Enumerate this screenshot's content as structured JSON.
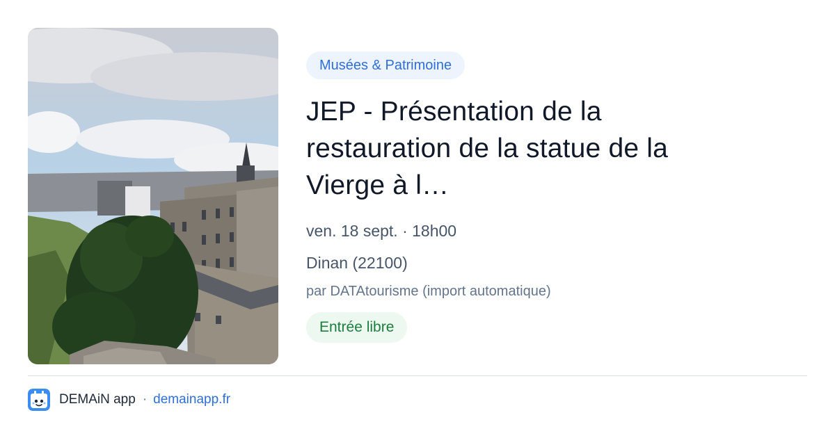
{
  "event": {
    "category": "Musées & Patrimoine",
    "title": "JEP - Présentation de la restauration de la statue de la Vierge à l…",
    "datetime": "ven. 18 sept. · 18h00",
    "location": "Dinan (22100)",
    "author": "par DATAtourisme (import automatique)",
    "price": "Entrée libre",
    "image_icon": "town-photo"
  },
  "footer": {
    "app_name": "DEMAiN app",
    "separator": "·",
    "domain": "demainapp.fr",
    "logo_icon": "app-logo-icon"
  },
  "colors": {
    "category_bg": "#edf4fe",
    "category_text": "#2f6fd6",
    "price_bg": "#ecf8f0",
    "price_text": "#1a7f3c",
    "link": "#2f6fd6"
  }
}
